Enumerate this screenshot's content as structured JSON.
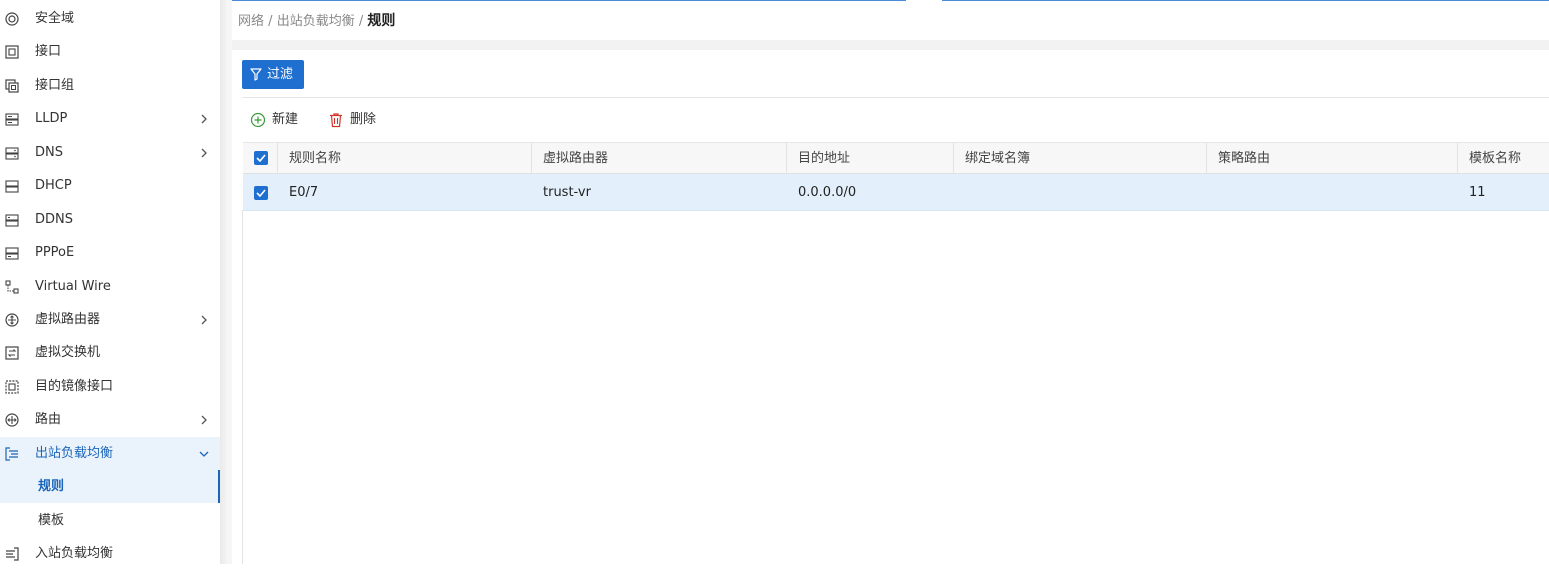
{
  "sidebar": {
    "items": [
      {
        "label": "安全域",
        "icon": "security-zone-icon"
      },
      {
        "label": "接口",
        "icon": "interface-icon"
      },
      {
        "label": "接口组",
        "icon": "interface-group-icon"
      },
      {
        "label": "LLDP",
        "icon": "lldp-icon"
      },
      {
        "label": "DNS",
        "icon": "dns-icon"
      },
      {
        "label": "DHCP",
        "icon": "dhcp-icon"
      },
      {
        "label": "DDNS",
        "icon": "ddns-icon"
      },
      {
        "label": "PPPoE",
        "icon": "pppoe-icon"
      },
      {
        "label": "Virtual Wire",
        "icon": "virtual-wire-icon"
      },
      {
        "label": "虚拟路由器",
        "icon": "virtual-router-icon"
      },
      {
        "label": "虚拟交换机",
        "icon": "virtual-switch-icon"
      },
      {
        "label": "目的镜像接口",
        "icon": "mirror-interface-icon"
      },
      {
        "label": "路由",
        "icon": "routing-icon"
      },
      {
        "label": "出站负载均衡",
        "icon": "outbound-lb-icon"
      },
      {
        "label": "入站负载均衡",
        "icon": "inbound-lb-icon"
      }
    ],
    "sub_items": [
      {
        "label": "规则"
      },
      {
        "label": "模板"
      }
    ],
    "active_color": "#1b65b9"
  },
  "breadcrumb": {
    "part1": "网络",
    "sep": "/",
    "part2": "出站负载均衡",
    "current": "规则"
  },
  "toolbar": {
    "filter_label": "过滤",
    "new_label": "新建",
    "delete_label": "删除"
  },
  "table": {
    "columns": [
      "规则名称",
      "虚拟路由器",
      "目的地址",
      "绑定域名簿",
      "策略路由",
      "模板名称"
    ],
    "rows": [
      {
        "name": "E0/7",
        "vrouter": "trust-vr",
        "dest": "0.0.0.0/0",
        "domain_book": "",
        "policy_route": "",
        "template": "11",
        "checked": true
      }
    ]
  },
  "colors": {
    "primary": "#1f6fd1",
    "selected_row": "#e3f0fb",
    "new_icon": "#3a9a3a",
    "delete_icon": "#d0362c"
  }
}
